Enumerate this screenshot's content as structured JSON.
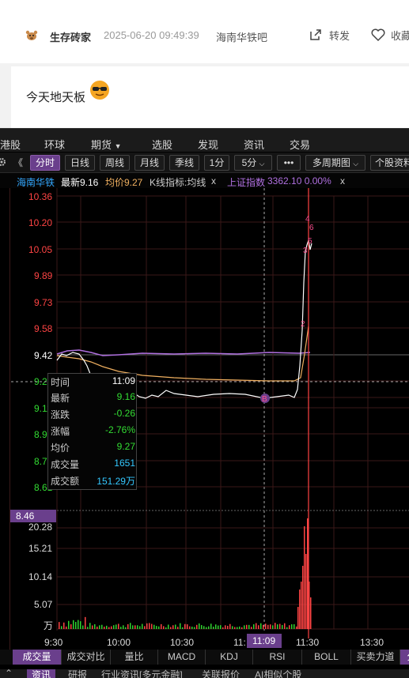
{
  "post": {
    "username": "生存砖家",
    "timestamp": "2025-06-20 09:49:39",
    "forum": "海南华铁吧",
    "share_label": "转发",
    "favorite_label": "收藏",
    "text": "今天地天板"
  },
  "terminal": {
    "top_menu": [
      "港股",
      "环球",
      "期货",
      "选股",
      "发现",
      "资讯",
      "交易"
    ],
    "top_menu_dropdown": "期货",
    "toolbar": {
      "nav_prev": "《",
      "buttons": [
        "分时",
        "日线",
        "周线",
        "月线",
        "季线",
        "1分",
        "5分",
        "•••",
        "多周期图",
        "个股资料"
      ],
      "active": "分时"
    },
    "info_bar": {
      "stock_name": "海南华铁",
      "latest": "最新9.16",
      "avg": "均价9.27",
      "indicator": "K线指标:均线",
      "close1": "x",
      "index_name": "上证指数",
      "index_value": "3362.10 0.00%",
      "close2": "x"
    },
    "price_axis": [
      "10.36",
      "10.20",
      "10.05",
      "9.89",
      "9.73",
      "9.58",
      "9.42",
      "9.27",
      "9.11",
      "8.96",
      "8.77",
      "8.61",
      "8.46"
    ],
    "current_price_tag": "8.46",
    "volume_axis": [
      "20.28",
      "15.21",
      "10.14",
      "5.07",
      "万"
    ],
    "time_axis": [
      "9:30",
      "10:00",
      "10:30",
      "11:",
      "11:30",
      "13:30"
    ],
    "crosshair_time": "11:09",
    "marks": [
      "4",
      "6",
      "5",
      "3",
      "2",
      "B",
      "1",
      "3",
      "4",
      "5",
      "6",
      "9"
    ],
    "tooltip": {
      "time_label": "时间",
      "time_value": "11:09",
      "latest_label": "最新",
      "latest_value": "9.16",
      "change_label": "涨跌",
      "change_value": "-0.26",
      "pct_label": "涨幅",
      "pct_value": "-2.76%",
      "avg_label": "均价",
      "avg_value": "9.27",
      "vol_label": "成交量",
      "vol_value": "1651",
      "amount_label": "成交额",
      "amount_value": "151.29万"
    },
    "bottom_tabs": [
      "成交量",
      "成交对比",
      "量比",
      "MACD",
      "KDJ",
      "RSI",
      "BOLL",
      "买卖力道",
      "分"
    ],
    "bottom_tabs_active": "成交量",
    "bottom_nav": [
      "资讯",
      "研报",
      "行业资讯[多元金融]",
      "关联报价",
      "AI相似个股"
    ],
    "bottom_nav_active": "资讯"
  },
  "colors": {
    "up": "#ff3b3b",
    "down": "#2fd52f",
    "price_line": "#ffffff",
    "avg_line": "#f0b060",
    "index_line": "#b070e0",
    "accent": "#6a3f8c",
    "cyan": "#33c8ff"
  }
}
